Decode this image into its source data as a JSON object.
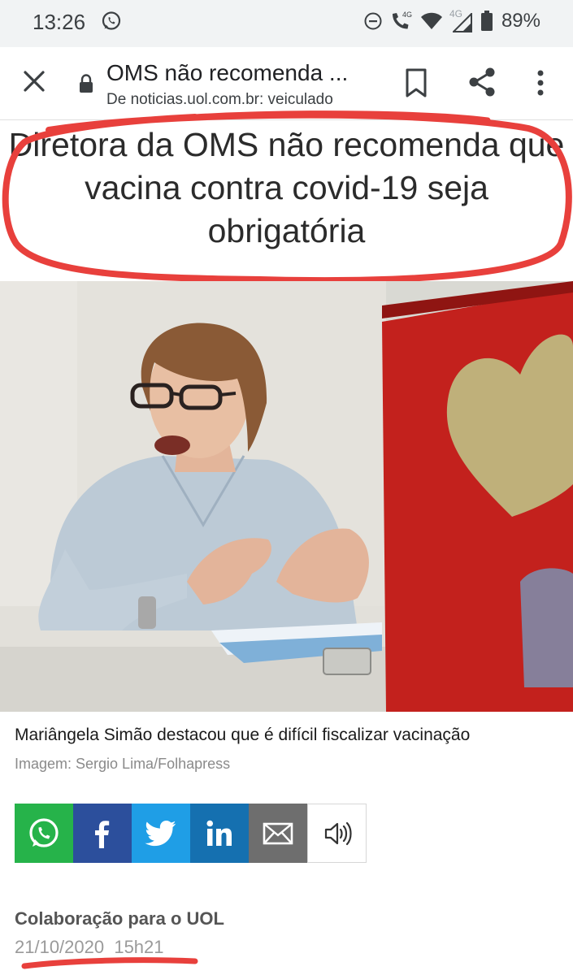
{
  "status_bar": {
    "time": "13:26",
    "battery": "89%",
    "network_left": "4G",
    "network_right": "4G",
    "icons": [
      "whatsapp-icon",
      "dnd-icon",
      "wifi-calling-icon",
      "wifi-icon",
      "signal-icon",
      "battery-icon"
    ]
  },
  "tab_bar": {
    "title": "OMS não recomenda ...",
    "url": "De noticias.uol.com.br: veiculado",
    "icons": [
      "close-icon",
      "lock-icon",
      "bookmark-icon",
      "share-icon",
      "more-vert-icon"
    ]
  },
  "article": {
    "headline": "Diretora da OMS não recomenda que vacina contra covid-19 seja obrigatória",
    "caption": "Mariângela Simão destacou que é difícil fiscalizar vacinação",
    "credit": "Imagem: Sergio Lima/Folhapress",
    "share_buttons": [
      {
        "name": "whatsapp",
        "icon": "whatsapp-icon",
        "color": "#26b34a"
      },
      {
        "name": "facebook",
        "icon": "facebook-icon",
        "color": "#2c4f9c"
      },
      {
        "name": "twitter",
        "icon": "twitter-icon",
        "color": "#1f9ee6"
      },
      {
        "name": "linkedin",
        "icon": "linkedin-icon",
        "color": "#1570b0"
      },
      {
        "name": "email",
        "icon": "mail-icon",
        "color": "#6e6e6e"
      },
      {
        "name": "audio",
        "icon": "speaker-icon",
        "color": "#ffffff"
      }
    ],
    "byline": "Colaboração para o UOL",
    "date": "21/10/2020  15h21"
  },
  "colors": {
    "annotation_red": "#e8403c",
    "status_bar_bg": "#f1f3f4"
  }
}
